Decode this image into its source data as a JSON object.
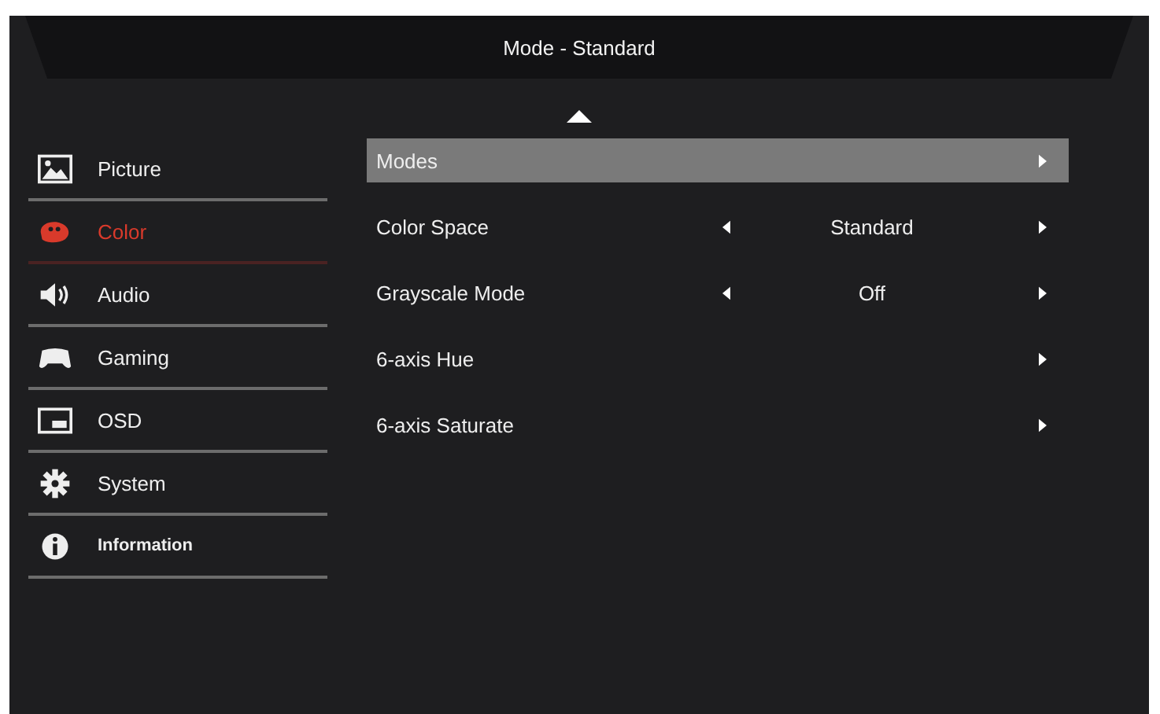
{
  "header": {
    "title": "Mode - Standard"
  },
  "sidebar": {
    "items": [
      {
        "label": "Picture",
        "selected": false
      },
      {
        "label": "Color",
        "selected": true
      },
      {
        "label": "Audio",
        "selected": false
      },
      {
        "label": "Gaming",
        "selected": false
      },
      {
        "label": "OSD",
        "selected": false
      },
      {
        "label": "System",
        "selected": false
      },
      {
        "label": "Information",
        "selected": false
      }
    ]
  },
  "menu": {
    "rows": [
      {
        "kind": "submenu",
        "label": "Modes",
        "selected": true
      },
      {
        "kind": "option",
        "label": "Color Space",
        "value": "Standard",
        "selected": false
      },
      {
        "kind": "option",
        "label": "Grayscale Mode",
        "value": "Off",
        "selected": false
      },
      {
        "kind": "submenu",
        "label": "6-axis Hue",
        "selected": false
      },
      {
        "kind": "submenu",
        "label": "6-axis Saturate",
        "selected": false
      }
    ]
  }
}
